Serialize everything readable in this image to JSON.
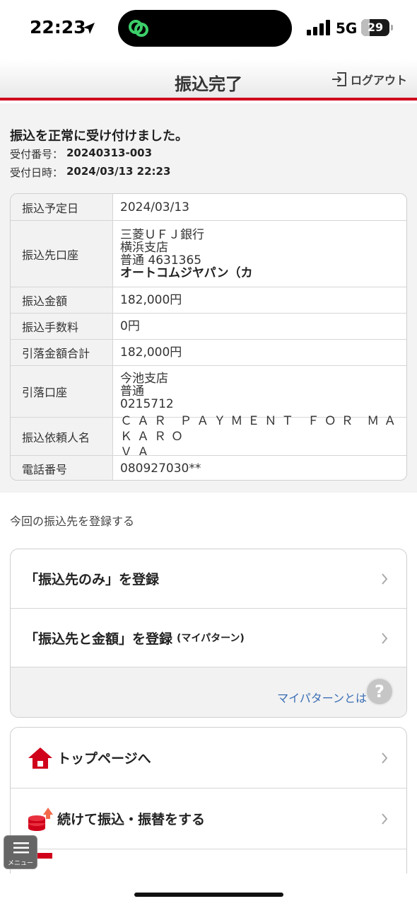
{
  "status_bar": {
    "time": "22:23",
    "network": "5G",
    "battery": "29",
    "battery_level": 0.29
  },
  "header": {
    "title": "振込完了",
    "logout_label": "ログアウト"
  },
  "notice": {
    "message": "振込を正常に受け付けました。",
    "receipt_number_label": "受付番号：",
    "receipt_number": "20240313-003",
    "receipt_datetime_label": "受付日時：",
    "receipt_datetime": "2024/03/13 22:23"
  },
  "details": {
    "scheduled_date": {
      "label": "振込予定日",
      "value": "2024/03/13"
    },
    "destination": {
      "label": "振込先口座",
      "bank": "三菱ＵＦＪ銀行",
      "branch": "横浜支店",
      "account": "普通 4631365",
      "holder": "オートコムジヤパン（カ"
    },
    "amount": {
      "label": "振込金額",
      "value": "182,000円"
    },
    "fee": {
      "label": "振込手数料",
      "value": "0円"
    },
    "total": {
      "label": "引落金額合計",
      "value": "182,000円"
    },
    "source": {
      "label": "引落口座",
      "branch": "今池支店",
      "type": "普通",
      "account": "0215712"
    },
    "requester": {
      "label": "振込依頼人名",
      "line1": "ＣＡＲ ＰＡＹＭＥＮＴ ＦＯＲ ＭＡＫＡＲＯ",
      "line2": "ＶＡ"
    },
    "phone": {
      "label": "電話番号",
      "value": "080927030**"
    }
  },
  "register": {
    "section_label": "今回の振込先を登録する",
    "only_destination": "「振込先のみ」を登録",
    "destination_and_amount": "「振込先と金額」を登録",
    "destination_and_amount_note": "(マイパターン)",
    "my_pattern_link": "マイパターンとは",
    "help_glyph": "?"
  },
  "nav": {
    "top_page": "トップページへ",
    "continue_transfer": "続けて振込・振替をする"
  },
  "menu": {
    "label": "メニュー"
  },
  "colors": {
    "accent": "#d0021b",
    "link": "#3b6fb5"
  }
}
